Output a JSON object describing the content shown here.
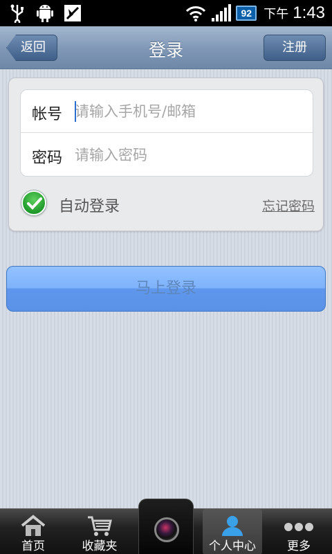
{
  "status_bar": {
    "battery_level": "92",
    "ampm": "下午",
    "time": "1:43",
    "icons": [
      "usb-icon",
      "android-debug-icon",
      "signal-off-icon",
      "wifi-icon",
      "cell-signal-icon",
      "battery-icon"
    ]
  },
  "header": {
    "title": "登录",
    "back_label": "返回",
    "register_label": "注册"
  },
  "form": {
    "account_label": "帐号",
    "account_placeholder": "请输入手机号/邮箱",
    "account_value": "",
    "password_label": "密码",
    "password_placeholder": "请输入密码",
    "password_value": "",
    "auto_login_label": "自动登录",
    "auto_login_checked": true,
    "forgot_label": "忘记密码"
  },
  "login_button_label": "马上登录",
  "tabbar": {
    "items": [
      {
        "label": "首页",
        "icon": "home-icon"
      },
      {
        "label": "收藏夹",
        "icon": "cart-icon"
      },
      {
        "label": "",
        "icon": "camera-icon"
      },
      {
        "label": "个人中心",
        "icon": "person-icon",
        "active": true
      },
      {
        "label": "更多",
        "icon": "more-icon"
      }
    ]
  },
  "colors": {
    "header_bg": "#7f97b5",
    "login_button": "#7eb2fb",
    "check_green": "#1f9a2a"
  }
}
